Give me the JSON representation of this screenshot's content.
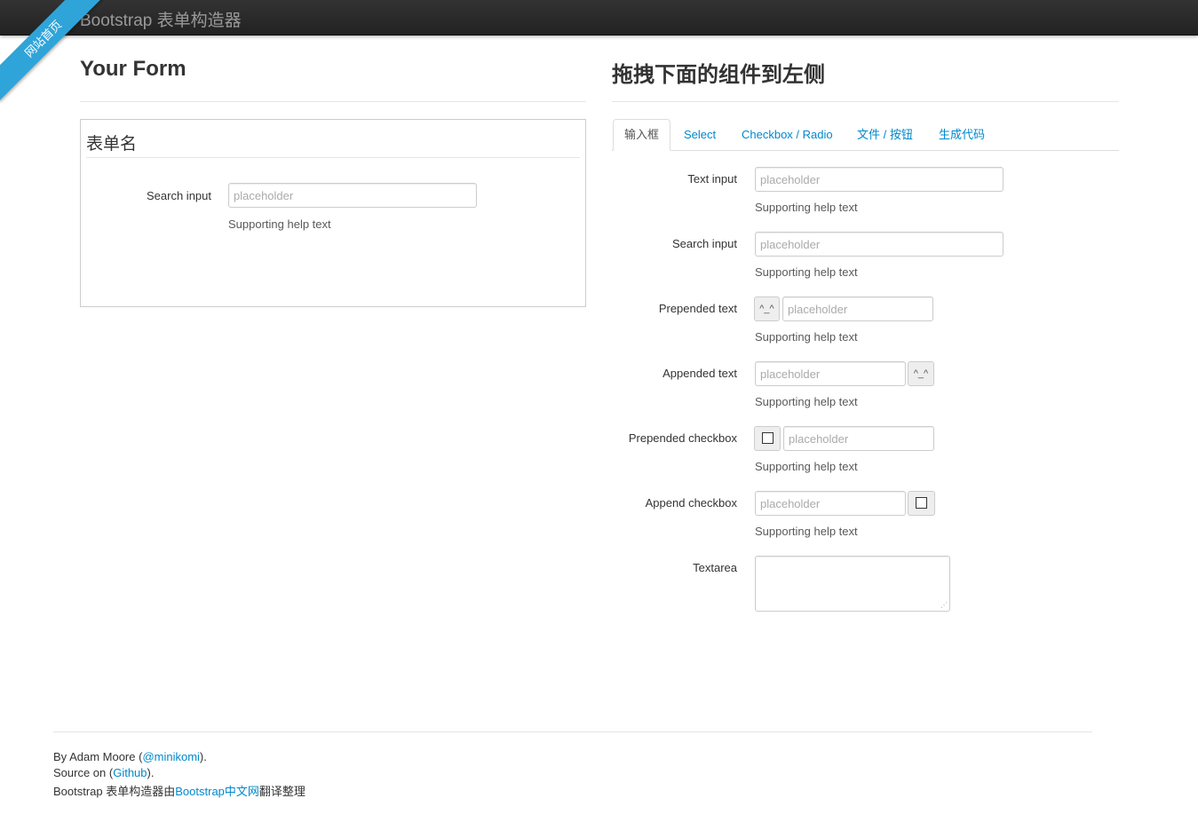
{
  "navbar": {
    "brand": "Bootstrap 表单构造器"
  },
  "ribbon": {
    "label": "网站首页"
  },
  "left": {
    "title": "Your Form",
    "form": {
      "legend": "表单名",
      "search_label": "Search input",
      "search_placeholder": "placeholder",
      "search_help": "Supporting help text"
    }
  },
  "right": {
    "title": "拖拽下面的组件到左侧",
    "tabs": [
      {
        "label": "输入框",
        "active": true
      },
      {
        "label": "Select"
      },
      {
        "label": "Checkbox / Radio"
      },
      {
        "label": "文件 / 按钮"
      },
      {
        "label": "生成代码"
      }
    ],
    "components": {
      "text_input": {
        "label": "Text input",
        "placeholder": "placeholder",
        "help": "Supporting help text"
      },
      "search_input": {
        "label": "Search input",
        "placeholder": "placeholder",
        "help": "Supporting help text"
      },
      "prepended_text": {
        "label": "Prepended text",
        "addon": "^_^",
        "placeholder": "placeholder",
        "help": "Supporting help text"
      },
      "appended_text": {
        "label": "Appended text",
        "addon": "^_^",
        "placeholder": "placeholder",
        "help": "Supporting help text"
      },
      "prepended_checkbox": {
        "label": "Prepended checkbox",
        "placeholder": "placeholder",
        "help": "Supporting help text"
      },
      "append_checkbox": {
        "label": "Append checkbox",
        "placeholder": "placeholder",
        "help": "Supporting help text"
      },
      "textarea": {
        "label": "Textarea"
      }
    }
  },
  "footer": {
    "line1_prefix": "By Adam Moore (",
    "line1_link": "@minikomi",
    "line1_suffix": ").",
    "line2_prefix": "Source on (",
    "line2_link": "Github",
    "line2_suffix": ").",
    "line3_prefix": "Bootstrap 表单构造器由",
    "line3_link": "Bootstrap中文网",
    "line3_suffix": "翻译整理"
  },
  "colors": {
    "link": "#0088cc",
    "navbar": "#222222",
    "ribbon": "#2fa4d9"
  }
}
